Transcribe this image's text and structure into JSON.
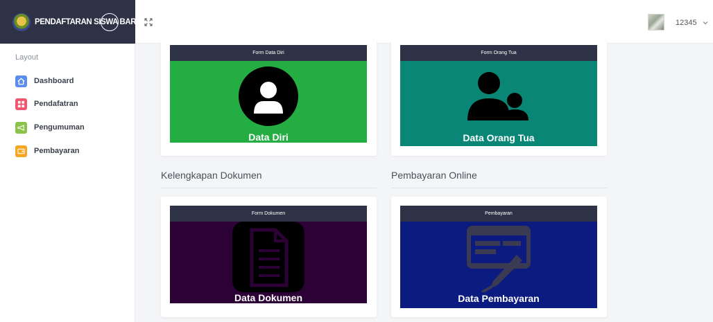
{
  "brand": {
    "title": "PENDAFTARAN SISWA BARU"
  },
  "sidebar": {
    "heading": "Layout",
    "items": [
      {
        "label": "Dashboard",
        "icon": "home-icon",
        "color": "#5b8def"
      },
      {
        "label": "Pendafatran",
        "icon": "grid-icon",
        "color": "#f2566e"
      },
      {
        "label": "Pengumuman",
        "icon": "megaphone-icon",
        "color": "#8bc34a"
      },
      {
        "label": "Pembayaran",
        "icon": "wallet-icon",
        "color": "#f5a623"
      }
    ]
  },
  "topbar": {
    "user_name": "12345"
  },
  "sections": [
    {
      "title": "Kelengkapan Dokumen"
    },
    {
      "title": "Pembayaran Online"
    }
  ],
  "cards": [
    {
      "header": "Form Data Diri",
      "title": "Data Diri",
      "bg": "#24ad43",
      "icon": "user-icon"
    },
    {
      "header": "Form Orang Tua",
      "title": "Data Orang Tua",
      "bg": "#098675",
      "icon": "users-icon"
    },
    {
      "header": "Form Dokumen",
      "title": "Data Dokumen",
      "bg": "#2c0136",
      "icon": "document-icon"
    },
    {
      "header": "Pembayaran",
      "title": "Data Pembayaran",
      "bg": "#0b1b80",
      "icon": "payment-icon"
    }
  ]
}
